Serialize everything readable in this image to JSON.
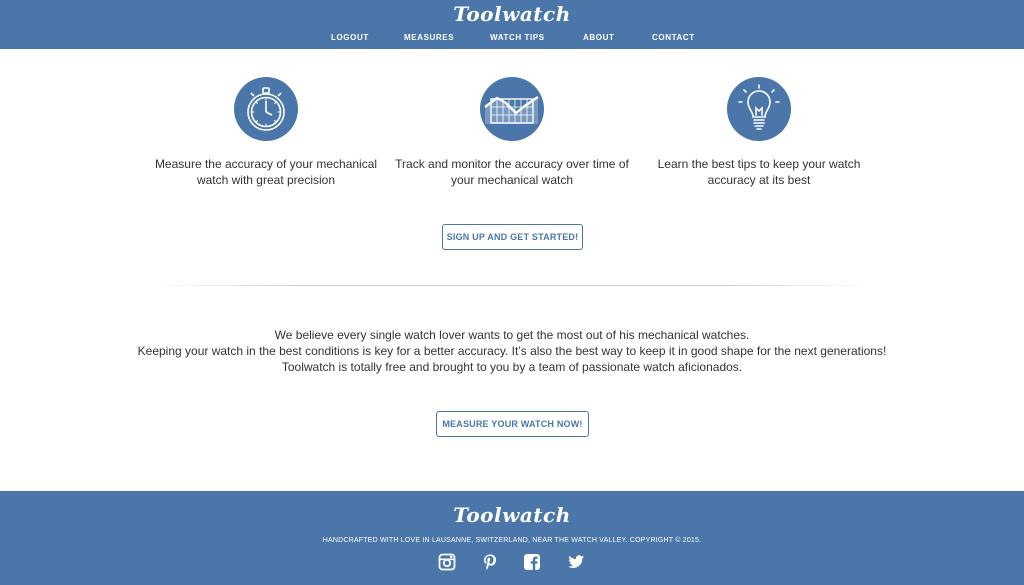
{
  "header": {
    "logo": "Toolwatch",
    "nav": [
      "LOGOUT",
      "MEASURES",
      "WATCH TIPS",
      "ABOUT",
      "CONTACT"
    ]
  },
  "features": [
    {
      "icon": "stopwatch-icon",
      "text_line1": "Measure the accuracy of your mechanical",
      "text_line2": "watch with great precision"
    },
    {
      "icon": "chart-icon",
      "text_line1": "Track and monitor the accuracy over time of",
      "text_line2": "your mechanical watch"
    },
    {
      "icon": "lightbulb-icon",
      "text_line1": "Learn the best tips to keep your watch",
      "text_line2": "accuracy at its best"
    }
  ],
  "signup_button": "SIGN UP AND GET STARTED!",
  "about": {
    "line1": "We believe every single watch lover wants to get the most out of his mechanical watches.",
    "line2": "Keeping your watch in the best conditions is key for a better accuracy. It’s also the best way to keep it in good shape for the next generations!",
    "line3": "Toolwatch is totally free and brought to you by a team of passionate watch aficionados."
  },
  "measure_button": "MEASURE YOUR WATCH NOW!",
  "footer": {
    "logo": "Toolwatch",
    "text": "HANDCRAFTED WITH LOVE IN LAUSANNE, SWITZERLAND, NEAR THE WATCH VALLEY. COPYRIGHT © 2015.",
    "social": [
      "instagram-icon",
      "pinterest-icon",
      "facebook-icon",
      "twitter-icon"
    ]
  },
  "colors": {
    "brand": "#4a76aa",
    "text": "#333333",
    "background": "#ffffff"
  }
}
